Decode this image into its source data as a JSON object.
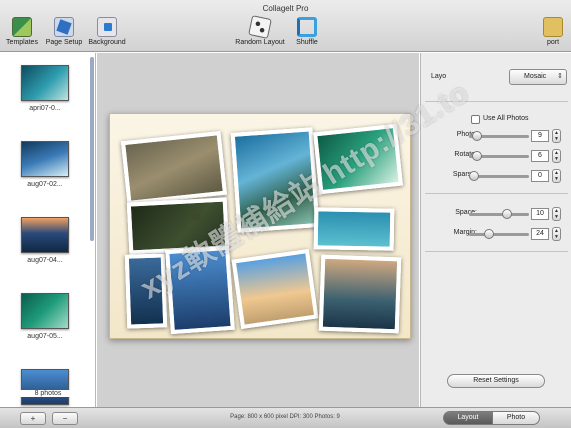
{
  "window": {
    "title": "Collagelt Pro"
  },
  "toolbar": {
    "templates_label": "Templates",
    "page_setup_label": "Page Setup",
    "background_label": "Background",
    "random_layout_label": "Random Layout",
    "shuffle_label": "Shuffle",
    "export_label": "port"
  },
  "sidebar": {
    "items": [
      {
        "label": "apri07-0..."
      },
      {
        "label": "aug07-02..."
      },
      {
        "label": "aug07-04..."
      },
      {
        "label": "aug07-05..."
      },
      {
        "label": ""
      }
    ],
    "photos_count": "8 photos"
  },
  "panel": {
    "layout_label": "Layo",
    "layout_value": "Mosaic",
    "use_all_photos_label": "Use All Photos",
    "use_all_photos_checked": false,
    "photo_label": "Photo:",
    "photo_value": "9",
    "photo_slider_level": 0.05,
    "rotate_label": "Rotate:",
    "rotate_value": "6",
    "rotate_slider_level": 0.05,
    "sparse_label": "Sparse:",
    "sparse_value": "0",
    "sparse_slider_level": 0.0,
    "space_label": "Space:",
    "space_value": "10",
    "space_slider_level": 0.65,
    "margin_label": "Margin:",
    "margin_value": "24",
    "margin_slider_level": 0.3,
    "reset_label": "Reset Settings"
  },
  "bottombar": {
    "add_label": "+",
    "remove_label": "−",
    "status": "Page: 800 x 600 pixel DPI: 300 Photos: 9",
    "tab_layout": "Layout",
    "tab_photo": "Photo"
  },
  "watermark": {
    "text": "xyz軟體補給站 http://31.to"
  }
}
